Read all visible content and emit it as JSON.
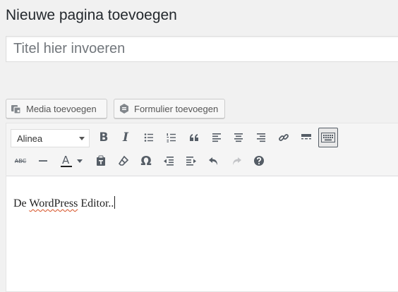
{
  "page": {
    "title": "Nieuwe pagina toevoegen"
  },
  "title_field": {
    "placeholder": "Titel hier invoeren",
    "value": ""
  },
  "media_buttons": [
    {
      "label": "Media toevoegen",
      "icon": "media-icon"
    },
    {
      "label": "Formulier toevoegen",
      "icon": "form-icon"
    }
  ],
  "toolbar": {
    "format_select": {
      "value": "Alinea"
    },
    "row1": [
      "bold-icon",
      "italic-icon",
      "bullet-list-icon",
      "numbered-list-icon",
      "blockquote-icon",
      "align-left-icon",
      "align-center-icon",
      "align-right-icon",
      "link-icon",
      "read-more-icon",
      "toolbar-toggle-icon"
    ],
    "row2": [
      "strikethrough-icon",
      "horizontal-line-icon",
      "text-color-icon",
      "paste-text-icon",
      "clear-formatting-icon",
      "special-character-icon",
      "outdent-icon",
      "indent-icon",
      "undo-icon",
      "redo-icon",
      "help-icon"
    ],
    "bold": "B",
    "italic": "I",
    "text_color": "A",
    "special_char": "Ω",
    "strike": "ABC"
  },
  "editor": {
    "content_before": "De ",
    "content_misspelled": "WordPress",
    "content_after": " Editor.."
  },
  "colors": {
    "background": "#f1f1f1",
    "text": "#23282d",
    "icon": "#555d66",
    "spellcheck": "#d54e21"
  }
}
